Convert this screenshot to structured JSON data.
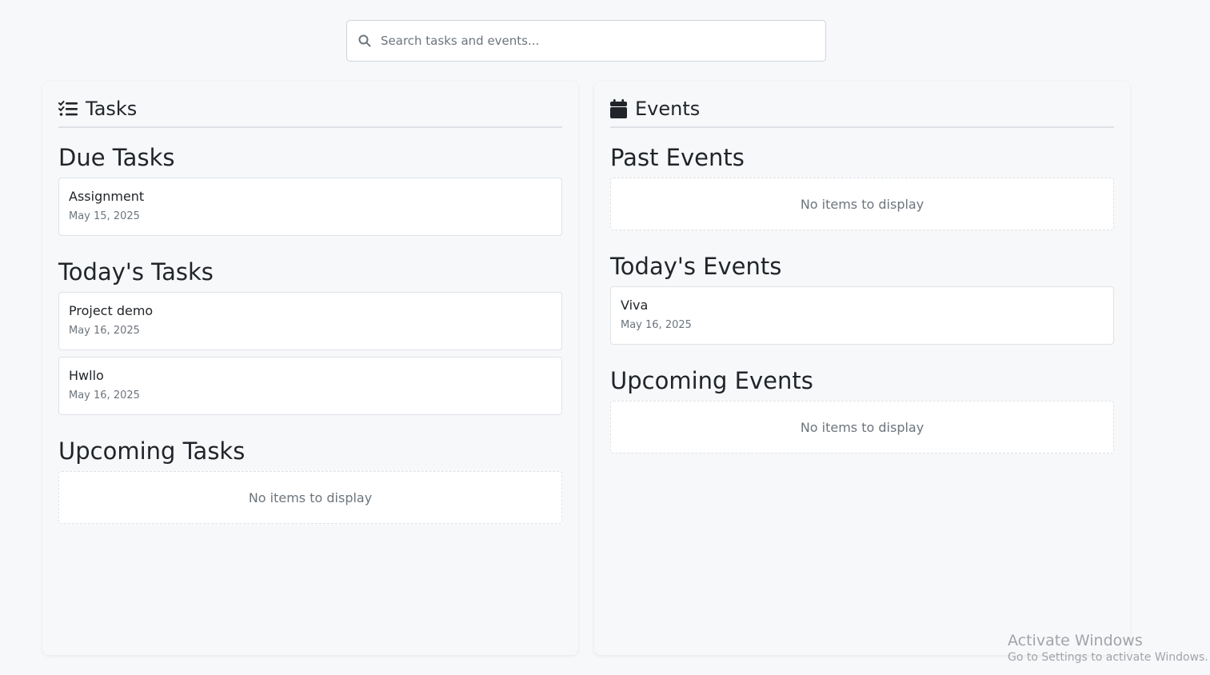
{
  "search": {
    "placeholder": "Search tasks and events..."
  },
  "tasks": {
    "header": "Tasks",
    "due": {
      "title": "Due Tasks",
      "items": [
        {
          "title": "Assignment",
          "date": "May 15, 2025"
        }
      ]
    },
    "today": {
      "title": "Today's Tasks",
      "items": [
        {
          "title": "Project demo",
          "date": "May 16, 2025"
        },
        {
          "title": "Hwllo",
          "date": "May 16, 2025"
        }
      ]
    },
    "upcoming": {
      "title": "Upcoming Tasks",
      "empty_text": "No items to display"
    }
  },
  "events": {
    "header": "Events",
    "past": {
      "title": "Past Events",
      "empty_text": "No items to display"
    },
    "today": {
      "title": "Today's Events",
      "items": [
        {
          "title": "Viva",
          "date": "May 16, 2025"
        }
      ]
    },
    "upcoming": {
      "title": "Upcoming Events",
      "empty_text": "No items to display"
    }
  },
  "watermark": {
    "title": "Activate Windows",
    "subtitle": "Go to Settings to activate Windows."
  },
  "icons": {
    "search": "search-icon",
    "tasks": "tasks-list-icon",
    "events": "calendar-icon"
  }
}
